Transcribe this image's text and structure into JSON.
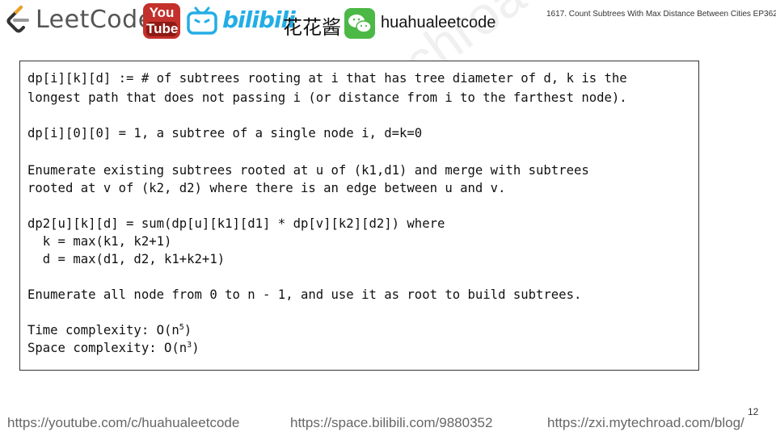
{
  "header": {
    "logo_text": "LeetCode",
    "youtube_line1": "You",
    "youtube_line2": "Tube",
    "bilibili_text": "bilibili",
    "bilibili_name": "花花酱",
    "wechat_handle": "huahualeetcode",
    "episode_title": "1617. Count Subtrees With Max Distance Between Cities EP362"
  },
  "content": {
    "def_line1": "dp[i][k][d] := # of subtrees rooting at i that has tree diameter of d, k is the",
    "def_line2": "longest path that does not passing i (or distance from i to the farthest node).",
    "base_line": "dp[i][0][0] = 1, a subtree of a single node i, d=k=0",
    "enum_line1": "Enumerate existing subtrees rooted at u of (k1,d1) and merge with subtrees",
    "enum_line2": "rooted at v of (k2, d2) where there is an edge between u and v.",
    "trans_line1": "dp2[u][k][d] = sum(dp[u][k1][d1] * dp[v][k2][d2]) where",
    "trans_line2": "  k = max(k1, k2+1)",
    "trans_line3": "  d = max(d1, d2, k1+k2+1)",
    "root_line": "Enumerate all node from 0 to n - 1, and use it as root to build subtrees.",
    "time_prefix": "Time complexity: O(n",
    "time_exp": "5",
    "time_suffix": ")",
    "space_prefix": "Space complexity: O(n",
    "space_exp": "3",
    "space_suffix": ")"
  },
  "watermark": "https://zxi.mytechroad.com/blog/  花花酱 LeetCode",
  "page_number": "12",
  "footer": {
    "youtube": "https://youtube.com/c/huahualeetcode",
    "bilibili": "https://space.bilibili.com/9880352",
    "blog": "https://zxi.mytechroad.com/blog/"
  },
  "colors": {
    "youtube_red": "#c4302b",
    "bilibili_blue": "#23ade5",
    "wechat_green": "#4cb846",
    "leetcode_orange": "#f0a020"
  }
}
